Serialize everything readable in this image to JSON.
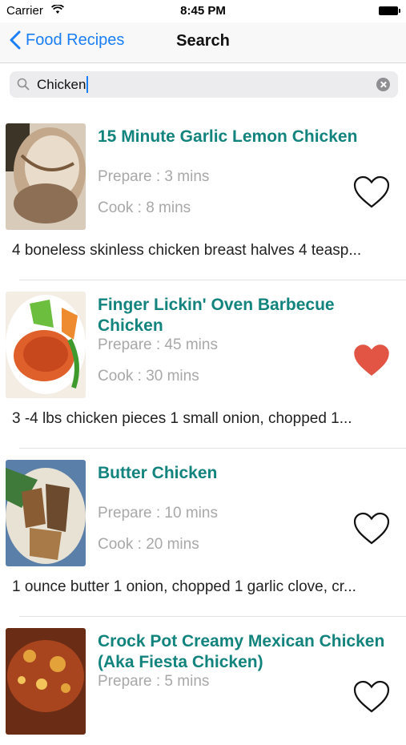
{
  "status": {
    "carrier": "Carrier",
    "time": "8:45 PM"
  },
  "nav": {
    "back_label": "Food Recipes",
    "title": "Search"
  },
  "search": {
    "value": "Chicken",
    "placeholder": "Search"
  },
  "recipes": [
    {
      "title": "15 Minute Garlic Lemon Chicken",
      "prepare": "Prepare : 3 mins",
      "cook": "Cook : 8 mins",
      "ingredients": "4 boneless skinless chicken breast halves  4 teasp...",
      "favorite": false,
      "thumb_colors": [
        "#8c6f55",
        "#e7ddd0",
        "#c9b9a4"
      ]
    },
    {
      "title": "Finger Lickin' Oven Barbecue Chicken",
      "prepare": "Prepare : 45 mins",
      "cook": "Cook : 30 mins",
      "ingredients": "3 -4 lbs chicken pieces  1 small onion, chopped  1...",
      "favorite": true,
      "thumb_colors": [
        "#e0602b",
        "#6cbf3e",
        "#f3ede3"
      ]
    },
    {
      "title": "Butter Chicken",
      "prepare": "Prepare : 10 mins",
      "cook": "Cook : 20 mins",
      "ingredients": "1 ounce butter  1 onion, chopped  1 garlic clove, cr...",
      "favorite": false,
      "thumb_colors": [
        "#6b4a2e",
        "#3f7a3a",
        "#a77a48"
      ]
    },
    {
      "title": "Crock Pot Creamy Mexican Chicken (Aka Fiesta Chicken)",
      "prepare": "Prepare : 5 mins",
      "cook": "",
      "ingredients": "",
      "favorite": false,
      "thumb_colors": [
        "#a8451f",
        "#e3a23a",
        "#6b2c16"
      ]
    }
  ],
  "colors": {
    "accent": "#1a7ef5",
    "title_teal": "#13837d",
    "heart_fill": "#e25545",
    "muted": "#a8a8a8"
  },
  "icons": {
    "back": "chevron-left-icon",
    "search": "magnifier-icon",
    "clear": "clear-circle-icon",
    "favorite": "heart-icon"
  }
}
